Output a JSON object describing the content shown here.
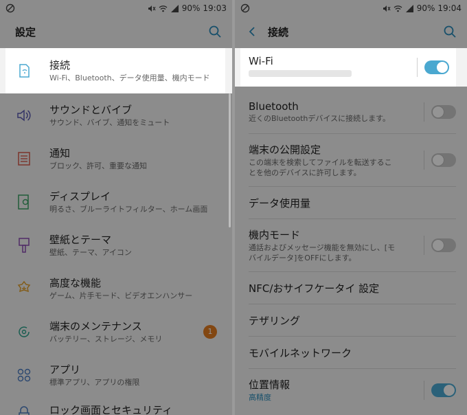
{
  "left": {
    "status": {
      "battery": "90%",
      "time": "19:03"
    },
    "title": "設定",
    "items": [
      {
        "label": "接続",
        "sub": "Wi-Fi、Bluetooth、データ使用量、機内モード"
      },
      {
        "label": "サウンドとバイブ",
        "sub": "サウンド、バイブ、通知をミュート"
      },
      {
        "label": "通知",
        "sub": "ブロック、許可、重要な通知"
      },
      {
        "label": "ディスプレイ",
        "sub": "明るさ、ブルーライトフィルター、ホーム画面"
      },
      {
        "label": "壁紙とテーマ",
        "sub": "壁紙、テーマ、アイコン"
      },
      {
        "label": "高度な機能",
        "sub": "ゲーム、片手モード、ビデオエンハンサー"
      },
      {
        "label": "端末のメンテナンス",
        "sub": "バッテリー、ストレージ、メモリ",
        "badge": "1"
      },
      {
        "label": "アプリ",
        "sub": "標準アプリ、アプリの権限"
      },
      {
        "label": "ロック画面とセキュリティ",
        "sub": ""
      }
    ]
  },
  "right": {
    "status": {
      "battery": "90%",
      "time": "19:04"
    },
    "title": "接続",
    "items": [
      {
        "label": "Wi-Fi",
        "toggle": true
      },
      {
        "label": "Bluetooth",
        "sub": "近くのBluetoothデバイスに接続します。",
        "toggle": false
      },
      {
        "label": "端末の公開設定",
        "sub1": "この端末を検索してファイルを転送するこ",
        "sub2": "とを他のデバイスに許可します。",
        "toggle": false
      },
      {
        "label": "データ使用量"
      },
      {
        "label": "機内モード",
        "sub1": "通話およびメッセージ機能を無効にし、[モ",
        "sub2": "バイルデータ]をOFFにします。",
        "toggle": false
      },
      {
        "label": "NFC/おサイフケータイ 設定"
      },
      {
        "label": "テザリング"
      },
      {
        "label": "モバイルネットワーク"
      },
      {
        "label": "位置情報",
        "sub": "高精度",
        "toggle": true
      }
    ]
  },
  "colors": {
    "accent": "#4aa8d0",
    "badge": "#e07a1f"
  },
  "icons": [
    "no-sim-icon",
    "mute-icon",
    "wifi-icon",
    "signal-icon",
    "search-icon",
    "back-icon",
    "connection-icon",
    "sound-icon",
    "notification-icon",
    "display-icon",
    "wallpaper-icon",
    "advanced-features-icon",
    "device-maintenance-icon",
    "apps-icon",
    "lock-icon"
  ]
}
